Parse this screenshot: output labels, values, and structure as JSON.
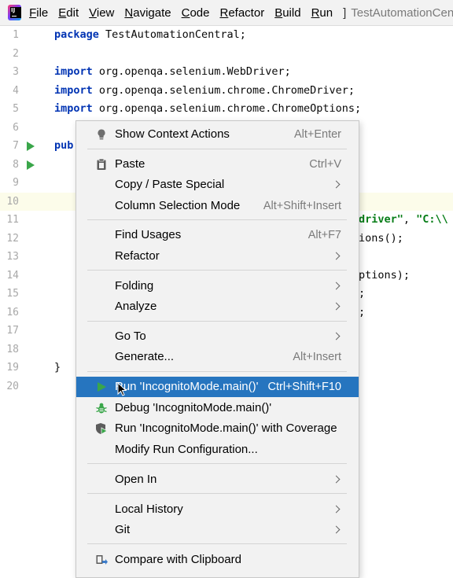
{
  "menubar": {
    "items": [
      "File",
      "Edit",
      "View",
      "Navigate",
      "Code",
      "Refactor",
      "Build",
      "Run"
    ],
    "mnemonics": [
      "F",
      "E",
      "V",
      "N",
      "C",
      "R",
      "B",
      "R"
    ],
    "separator": "]",
    "window_title": "TestAutomationCentral"
  },
  "editor": {
    "line_numbers": [
      "1",
      "2",
      "3",
      "4",
      "5",
      "6",
      "7",
      "8",
      "9",
      "10",
      "11",
      "12",
      "13",
      "14",
      "15",
      "16",
      "17",
      "18",
      "19",
      "20"
    ],
    "line1": {
      "kw": "package",
      "rest": " TestAutomationCentral;"
    },
    "line3": {
      "kw": "import",
      "rest": " org.openqa.selenium.WebDriver;"
    },
    "line4": {
      "kw": "import",
      "rest": " org.openqa.selenium.chrome.ChromeDriver;"
    },
    "line5": {
      "kw": "import",
      "rest": " org.openqa.selenium.chrome.ChromeOptions;"
    },
    "line7": "pub",
    "line11": {
      "str1": "driver\"",
      "mid": ", ",
      "str2": "\"C:\\\\"
    },
    "line12": "ions();",
    "line14": "ptions);",
    "line15": ";",
    "line16": ";",
    "line19": "}"
  },
  "context_menu": {
    "show_context_actions": {
      "label": "Show Context Actions",
      "shortcut": "Alt+Enter"
    },
    "paste": {
      "label": "Paste",
      "shortcut": "Ctrl+V"
    },
    "copy_paste_special": {
      "label": "Copy / Paste Special"
    },
    "column_selection_mode": {
      "label": "Column Selection Mode",
      "shortcut": "Alt+Shift+Insert"
    },
    "find_usages": {
      "label": "Find Usages",
      "shortcut": "Alt+F7"
    },
    "refactor": {
      "label": "Refactor"
    },
    "folding": {
      "label": "Folding"
    },
    "analyze": {
      "label": "Analyze"
    },
    "go_to": {
      "label": "Go To"
    },
    "generate": {
      "label": "Generate...",
      "shortcut": "Alt+Insert"
    },
    "run": {
      "label": "Run 'IncognitoMode.main()'",
      "shortcut": "Ctrl+Shift+F10"
    },
    "debug": {
      "label": "Debug 'IncognitoMode.main()'"
    },
    "run_coverage": {
      "label": "Run 'IncognitoMode.main()' with Coverage"
    },
    "modify_run": {
      "label": "Modify Run Configuration..."
    },
    "open_in": {
      "label": "Open In"
    },
    "local_history": {
      "label": "Local History"
    },
    "git": {
      "label": "Git"
    },
    "compare_clipboard": {
      "label": "Compare with Clipboard"
    }
  },
  "colors": {
    "selection": "#2675bf",
    "keyword": "#0033b3",
    "string": "#067d17",
    "run_icon": "#3aa64a",
    "debug_icon": "#3aa64a",
    "bulb_icon": "#6e6e6e"
  },
  "icons": [
    "lightbulb-icon",
    "clipboard-icon",
    "run-icon",
    "debug-bug-icon",
    "coverage-shield-icon",
    "compare-icon"
  ]
}
